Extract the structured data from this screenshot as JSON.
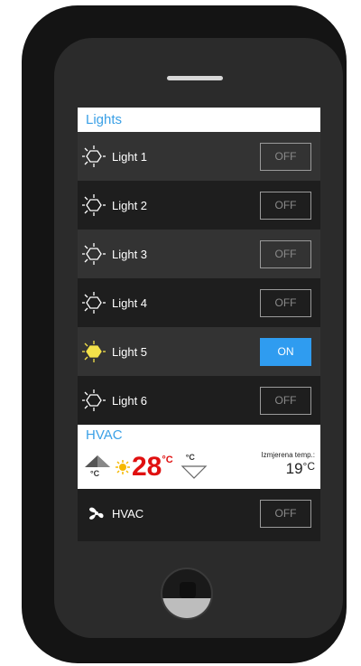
{
  "sections": {
    "lights": {
      "title": "Lights"
    },
    "hvac": {
      "title": "HVAC"
    }
  },
  "lights": [
    {
      "label": "Light 1",
      "state": "OFF",
      "on": false
    },
    {
      "label": "Light 2",
      "state": "OFF",
      "on": false
    },
    {
      "label": "Light 3",
      "state": "OFF",
      "on": false
    },
    {
      "label": "Light 4",
      "state": "OFF",
      "on": false
    },
    {
      "label": "Light 5",
      "state": "ON",
      "on": true
    },
    {
      "label": "Light 6",
      "state": "OFF",
      "on": false
    }
  ],
  "hvac": {
    "setpoint_value": "28",
    "setpoint_unit": "°C",
    "up_unit": "°C",
    "down_unit": "°C",
    "measured_label": "Izmjerena temp.:",
    "measured_value": "19",
    "measured_unit": "°C",
    "device_label": "HVAC",
    "device_state": "OFF"
  },
  "colors": {
    "accent_blue": "#2f9cf0",
    "header_text": "#3aa0e6",
    "setpoint_red": "#e01010",
    "bulb_on": "#f4e24a"
  }
}
